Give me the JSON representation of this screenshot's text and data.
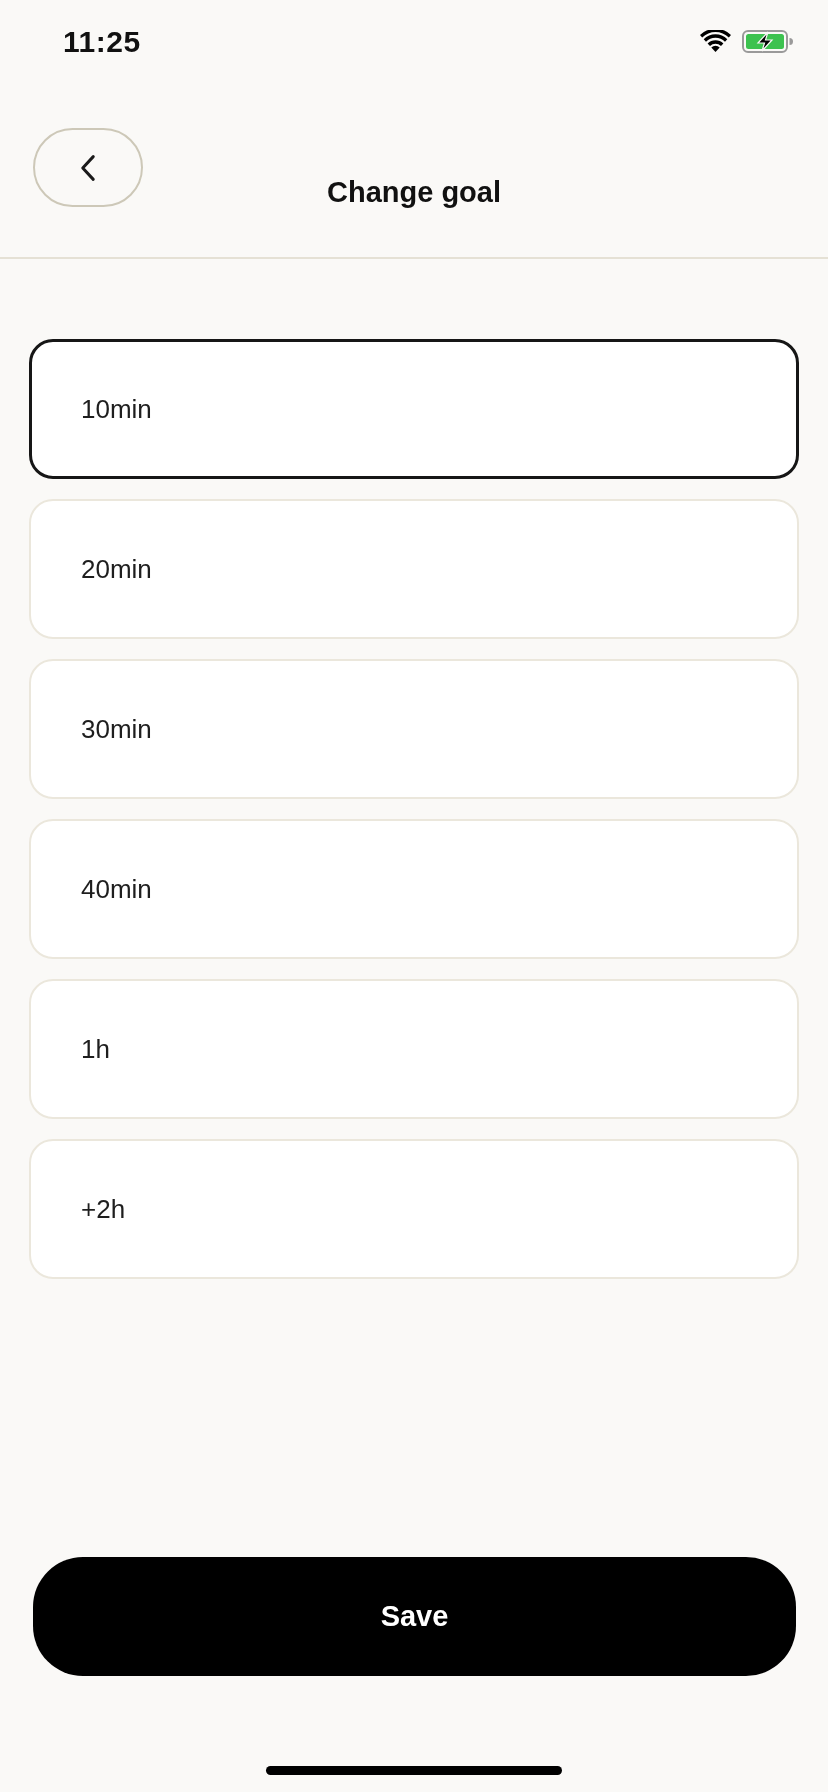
{
  "status_bar": {
    "time": "11:25"
  },
  "header": {
    "title": "Change goal"
  },
  "options": [
    {
      "label": "10min",
      "selected": true
    },
    {
      "label": "20min",
      "selected": false
    },
    {
      "label": "30min",
      "selected": false
    },
    {
      "label": "40min",
      "selected": false
    },
    {
      "label": "1h",
      "selected": false
    },
    {
      "label": "+2h",
      "selected": false
    }
  ],
  "save_button": {
    "label": "Save"
  }
}
